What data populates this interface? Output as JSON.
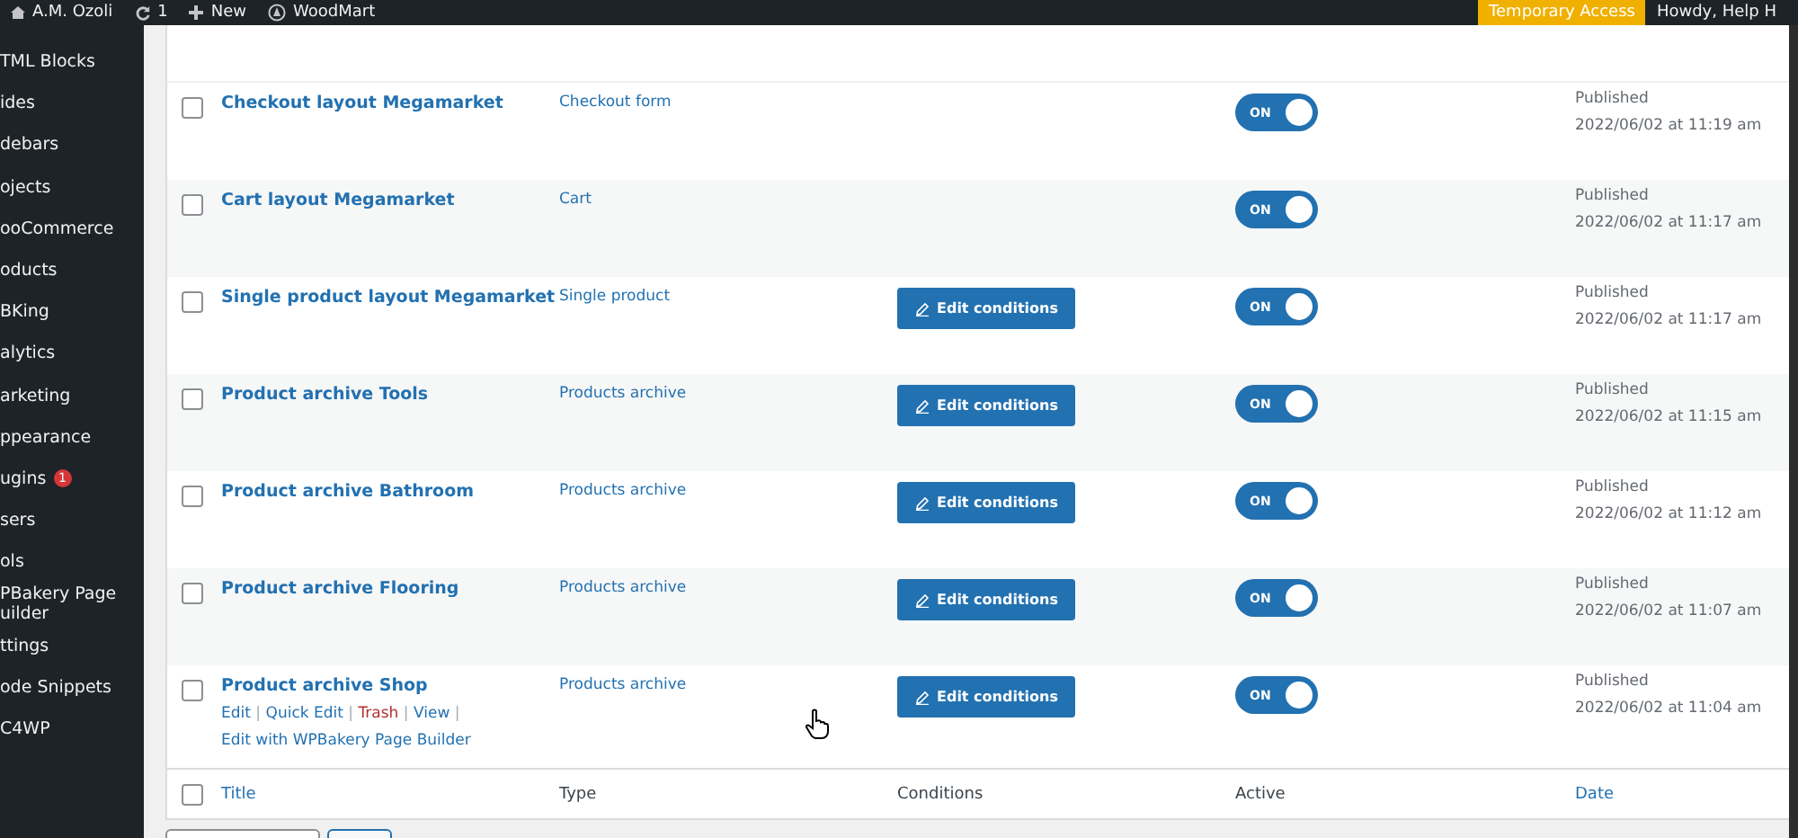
{
  "admin_bar": {
    "site": "A.M. Ozoli",
    "updates": "1",
    "new": "New",
    "theme": "WoodMart",
    "temporary_access": "Temporary Access",
    "howdy": "Howdy, Help H"
  },
  "sidebar": {
    "items": [
      {
        "label": "TML Blocks"
      },
      {
        "label": "ides"
      },
      {
        "label": "debars"
      },
      {
        "label": "ojects"
      },
      {
        "label": "ooCommerce"
      },
      {
        "label": "oducts"
      },
      {
        "label": "BKing"
      },
      {
        "label": "alytics"
      },
      {
        "label": "arketing"
      },
      {
        "label": "ppearance"
      },
      {
        "label": "ugins",
        "badge": "1"
      },
      {
        "label": "sers"
      },
      {
        "label": "ols"
      },
      {
        "label": "PBakery Page uilder"
      },
      {
        "label": "ttings"
      },
      {
        "label": "ode Snippets"
      },
      {
        "label": "C4WP"
      }
    ]
  },
  "table": {
    "rows": [
      {
        "checked": false,
        "title": "Checkout layout Megamarket",
        "type": "Checkout form",
        "active": {
          "on": true,
          "label": "ON"
        },
        "status": "Published",
        "date": "2022/06/02 at 11:19 am"
      },
      {
        "checked": false,
        "title": "Cart layout Megamarket",
        "type": "Cart",
        "active": {
          "on": true,
          "label": "ON"
        },
        "status": "Published",
        "date": "2022/06/02 at 11:17 am"
      },
      {
        "checked": false,
        "title": "Single product layout Megamarket",
        "type": "Single product",
        "conditions_button": "Edit conditions",
        "active": {
          "on": true,
          "label": "ON"
        },
        "status": "Published",
        "date": "2022/06/02 at 11:17 am"
      },
      {
        "checked": false,
        "title": "Product archive Tools",
        "type": "Products archive",
        "conditions_button": "Edit conditions",
        "active": {
          "on": true,
          "label": "ON"
        },
        "status": "Published",
        "date": "2022/06/02 at 11:15 am"
      },
      {
        "checked": false,
        "title": "Product archive Bathroom",
        "type": "Products archive",
        "conditions_button": "Edit conditions",
        "active": {
          "on": true,
          "label": "ON"
        },
        "status": "Published",
        "date": "2022/06/02 at 11:12 am"
      },
      {
        "checked": false,
        "title": "Product archive Flooring",
        "type": "Products archive",
        "conditions_button": "Edit conditions",
        "active": {
          "on": true,
          "label": "ON"
        },
        "status": "Published",
        "date": "2022/06/02 at 11:07 am"
      },
      {
        "checked": false,
        "title": "Product archive Shop",
        "type": "Products archive",
        "conditions_button": "Edit conditions",
        "active": {
          "on": true,
          "label": "ON"
        },
        "status": "Published",
        "date": "2022/06/02 at 11:04 am",
        "row_actions": [
          {
            "label": "Edit",
            "kind": "link"
          },
          {
            "label": "|",
            "kind": "separator"
          },
          {
            "label": "Quick Edit",
            "kind": "link"
          },
          {
            "label": "|",
            "kind": "separator"
          },
          {
            "label": "Trash",
            "kind": "delete"
          },
          {
            "label": "|",
            "kind": "separator"
          },
          {
            "label": "View",
            "kind": "link"
          },
          {
            "label": "|",
            "kind": "separator"
          },
          {
            "label": "Edit with WPBakery Page Builder",
            "kind": "link"
          }
        ]
      }
    ],
    "select_all_checked": false,
    "footer_columns": [
      {
        "label": "Title",
        "sortable": true
      },
      {
        "label": "Type",
        "sortable": false
      },
      {
        "label": "Conditions",
        "sortable": false
      },
      {
        "label": "Active",
        "sortable": false
      },
      {
        "label": "Date",
        "sortable": true
      }
    ]
  }
}
